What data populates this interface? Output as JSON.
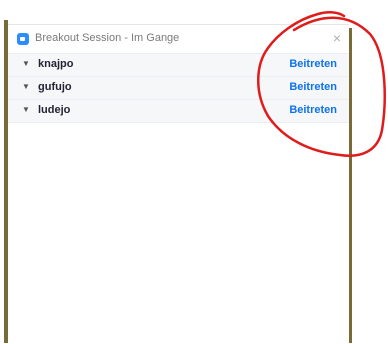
{
  "window": {
    "title": "Breakout Session - Im Gange",
    "close_label": "×"
  },
  "rooms": [
    {
      "name": "knajpo",
      "join_label": "Beitreten"
    },
    {
      "name": "gufujo",
      "join_label": "Beitreten"
    },
    {
      "name": "ludejo",
      "join_label": "Beitreten"
    }
  ],
  "colors": {
    "accent": "#0e72ed",
    "app_icon": "#2d8cff",
    "annotation": "#e01b1b"
  },
  "icons": {
    "app": "zoom-app-icon",
    "expand": "caret-down-icon",
    "close": "close-icon"
  }
}
